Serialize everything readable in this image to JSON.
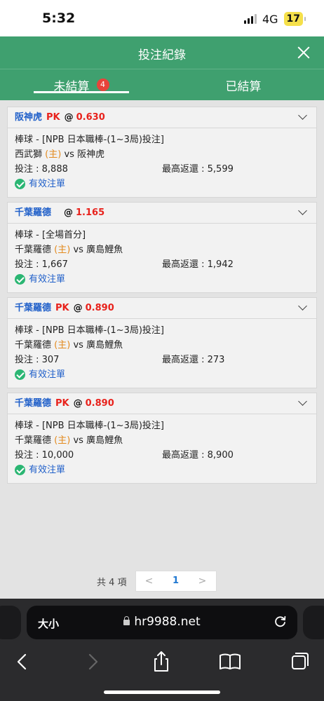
{
  "status_bar": {
    "time": "5:32",
    "network": "4G",
    "battery": "17"
  },
  "header": {
    "title": "投注紀錄"
  },
  "tabs": [
    {
      "label": "未結算",
      "badge": "4",
      "active": true
    },
    {
      "label": "已結算",
      "active": false
    }
  ],
  "bets": [
    {
      "team": "阪神虎",
      "pk": "PK",
      "at": "@",
      "odds": "0.630",
      "sport_line": "棒球 - [NPB 日本職棒-(1~3局)投注]",
      "home_team": "西武獅",
      "home_tag": "(主)",
      "vs": "vs",
      "away_team": "阪神虎",
      "stake": "投注 : 8,888",
      "max_return": "最高返還 : 5,599",
      "status": "有效注單"
    },
    {
      "team": "千葉羅德",
      "pk": "",
      "at": "@",
      "odds": "1.165",
      "sport_line": "棒球 - [全場首分]",
      "home_team": "千葉羅德",
      "home_tag": "(主)",
      "vs": "vs",
      "away_team": "廣島鯉魚",
      "stake": "投注 : 1,667",
      "max_return": "最高返還 : 1,942",
      "status": "有效注單"
    },
    {
      "team": "千葉羅德",
      "pk": "PK",
      "at": "@",
      "odds": "0.890",
      "sport_line": "棒球 - [NPB 日本職棒-(1~3局)投注]",
      "home_team": "千葉羅德",
      "home_tag": "(主)",
      "vs": "vs",
      "away_team": "廣島鯉魚",
      "stake": "投注 : 307",
      "max_return": "最高返還 : 273",
      "status": "有效注單"
    },
    {
      "team": "千葉羅德",
      "pk": "PK",
      "at": "@",
      "odds": "0.890",
      "sport_line": "棒球 - [NPB 日本職棒-(1~3局)投注]",
      "home_team": "千葉羅德",
      "home_tag": "(主)",
      "vs": "vs",
      "away_team": "廣島鯉魚",
      "stake": "投注 : 10,000",
      "max_return": "最高返還 : 8,900",
      "status": "有效注單"
    }
  ],
  "pagination": {
    "total": "共 4 項",
    "prev": "<",
    "current": "1",
    "next": ">"
  },
  "browser": {
    "text_size_label": "大小",
    "url": "hr9988.net"
  },
  "colors": {
    "header_green": "#3fa06f",
    "team_blue": "#1f5fc9",
    "odds_red": "#e8221c",
    "home_orange": "#e38a1e",
    "valid_green": "#2bb673"
  }
}
